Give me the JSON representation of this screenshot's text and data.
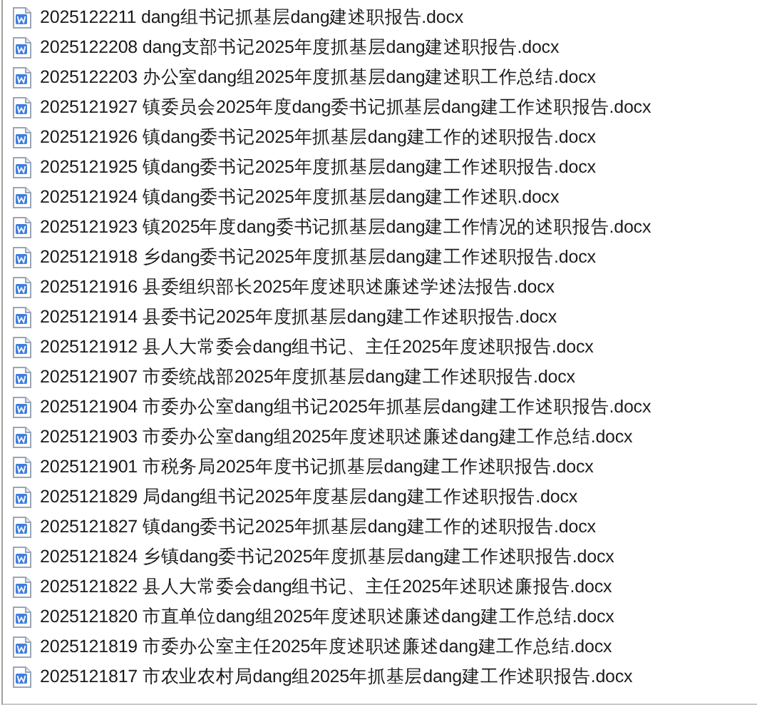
{
  "files": [
    {
      "name": "2025122211 dang组书记抓基层dang建述职报告.docx"
    },
    {
      "name": "2025122208 dang支部书记2025年度抓基层dang建述职报告.docx"
    },
    {
      "name": "2025122203 办公室dang组2025年度抓基层dang建述职工作总结.docx"
    },
    {
      "name": "2025121927 镇委员会2025年度dang委书记抓基层dang建工作述职报告.docx"
    },
    {
      "name": "2025121926 镇dang委书记2025年抓基层dang建工作的述职报告.docx"
    },
    {
      "name": "2025121925 镇dang委书记2025年度抓基层dang建工作述职报告.docx"
    },
    {
      "name": "2025121924 镇dang委书记2025年度抓基层dang建工作述职.docx"
    },
    {
      "name": "2025121923 镇2025年度dang委书记抓基层dang建工作情况的述职报告.docx"
    },
    {
      "name": "2025121918 乡dang委书记2025年度抓基层dang建工作述职报告.docx"
    },
    {
      "name": "2025121916 县委组织部长2025年度述职述廉述学述法报告.docx"
    },
    {
      "name": "2025121914 县委书记2025年度抓基层dang建工作述职报告.docx"
    },
    {
      "name": "2025121912 县人大常委会dang组书记、主任2025年度述职报告.docx"
    },
    {
      "name": "2025121907 市委统战部2025年度抓基层dang建工作述职报告.docx"
    },
    {
      "name": "2025121904 市委办公室dang组书记2025年抓基层dang建工作述职报告.docx"
    },
    {
      "name": "2025121903 市委办公室dang组2025年度述职述廉述dang建工作总结.docx"
    },
    {
      "name": "2025121901 市税务局2025年度书记抓基层dang建工作述职报告.docx"
    },
    {
      "name": "2025121829 局dang组书记2025年度基层dang建工作述职报告.docx"
    },
    {
      "name": "2025121827 镇dang委书记2025年抓基层dang建工作的述职报告.docx"
    },
    {
      "name": "2025121824 乡镇dang委书记2025年度抓基层dang建工作述职报告.docx"
    },
    {
      "name": "2025121822 县人大常委会dang组书记、主任2025年述职述廉报告.docx"
    },
    {
      "name": "2025121820 市直单位dang组2025年度述职述廉述dang建工作总结.docx"
    },
    {
      "name": "2025121819 市委办公室主任2025年度述职述廉述dang建工作总结.docx"
    },
    {
      "name": "2025121817 市农业农村局dang组2025年抓基层dang建工作述职报告.docx"
    }
  ]
}
